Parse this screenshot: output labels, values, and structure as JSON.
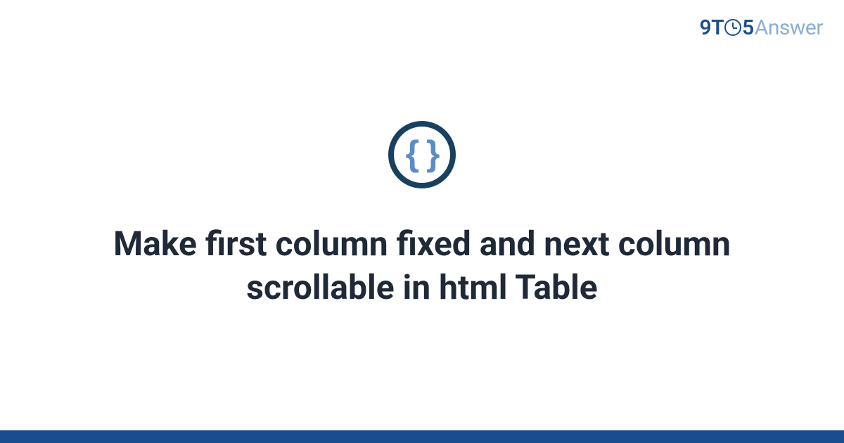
{
  "brand": {
    "part1": "9T",
    "part2": "5",
    "part3": "Answer"
  },
  "icon": {
    "name": "code-braces-icon",
    "glyph": "{ }"
  },
  "title": "Make first column fixed and next column scrollable in html Table",
  "colors": {
    "brand_blue": "#1a4d8f",
    "brand_light": "#8aaed8",
    "icon_ring": "#1a4060",
    "icon_glyph": "#5a8cc7",
    "heading": "#1f2937"
  }
}
